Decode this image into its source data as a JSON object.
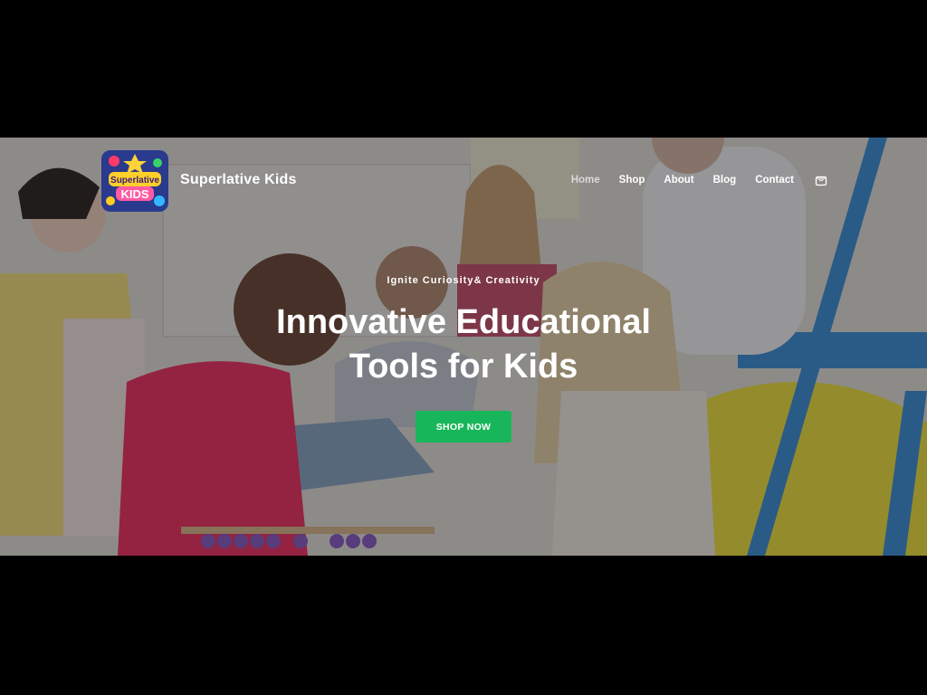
{
  "site": {
    "brand": "Superlative Kids",
    "logo_text": "Superlative KIDS"
  },
  "nav": {
    "items": [
      {
        "label": "Home",
        "active": true
      },
      {
        "label": "Shop",
        "active": false
      },
      {
        "label": "About",
        "active": false
      },
      {
        "label": "Blog",
        "active": false
      },
      {
        "label": "Contact",
        "active": false
      }
    ],
    "cart_icon": "shopping-bag-icon"
  },
  "hero": {
    "kicker": "Ignite Curiosity& Creativity",
    "headline_line1": "Innovative Educational",
    "headline_line2": "Tools for Kids",
    "cta_label": "SHOP NOW"
  },
  "colors": {
    "cta": "#18b65a",
    "text": "#ffffff",
    "nav_active": "#d9d9d9",
    "letterbox": "#000000"
  }
}
